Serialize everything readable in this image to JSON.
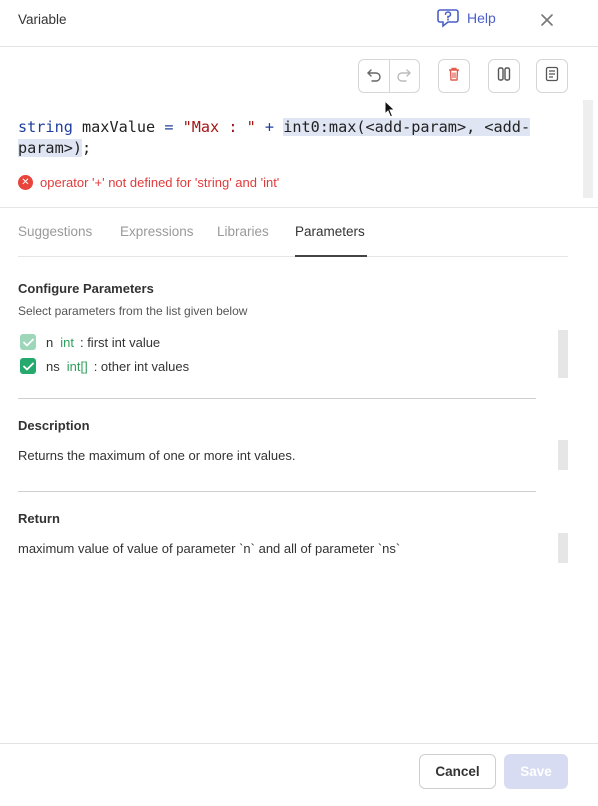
{
  "header": {
    "title": "Variable",
    "help_label": "Help",
    "help_icon": "help-chat-icon",
    "close_icon": "close-icon"
  },
  "toolbar": {
    "icons": [
      "undo-icon",
      "redo-icon",
      "delete-icon",
      "split-view-icon",
      "document-icon"
    ]
  },
  "editor": {
    "code": {
      "type_kw": "string",
      "var_decl": " maxValue ",
      "eq": "=",
      "str_lit": " \"Max : \" ",
      "plus": "+",
      "space": " ",
      "call_line1": "int0:max(<add-param>, <add-",
      "call_line2": "param>)",
      "semicolon": ";"
    },
    "error": "operator '+' not defined for 'string' and 'int'"
  },
  "tabs": {
    "items": [
      "Suggestions",
      "Expressions",
      "Libraries",
      "Parameters"
    ],
    "active": "Parameters"
  },
  "parameters": {
    "title": "Configure Parameters",
    "subtitle": "Select parameters from the list given below",
    "items": [
      {
        "name": "n",
        "type": "int",
        "desc": ": first int value",
        "checked": true
      },
      {
        "name": "ns",
        "type": "int[]",
        "desc": ": other int values",
        "checked": true
      }
    ]
  },
  "description": {
    "title": "Description",
    "text": "Returns the maximum of one or more int values."
  },
  "return": {
    "title": "Return",
    "text": "maximum value of value of parameter `n` and all of parameter `ns`"
  },
  "footer": {
    "cancel_label": "Cancel",
    "save_label": "Save"
  },
  "colors": {
    "accent": "#4a5fc7",
    "error": "#e03b3b",
    "checkbox": "#26a96c",
    "type": "#2f9e5d",
    "save_disabled": "#d7dcf3"
  }
}
